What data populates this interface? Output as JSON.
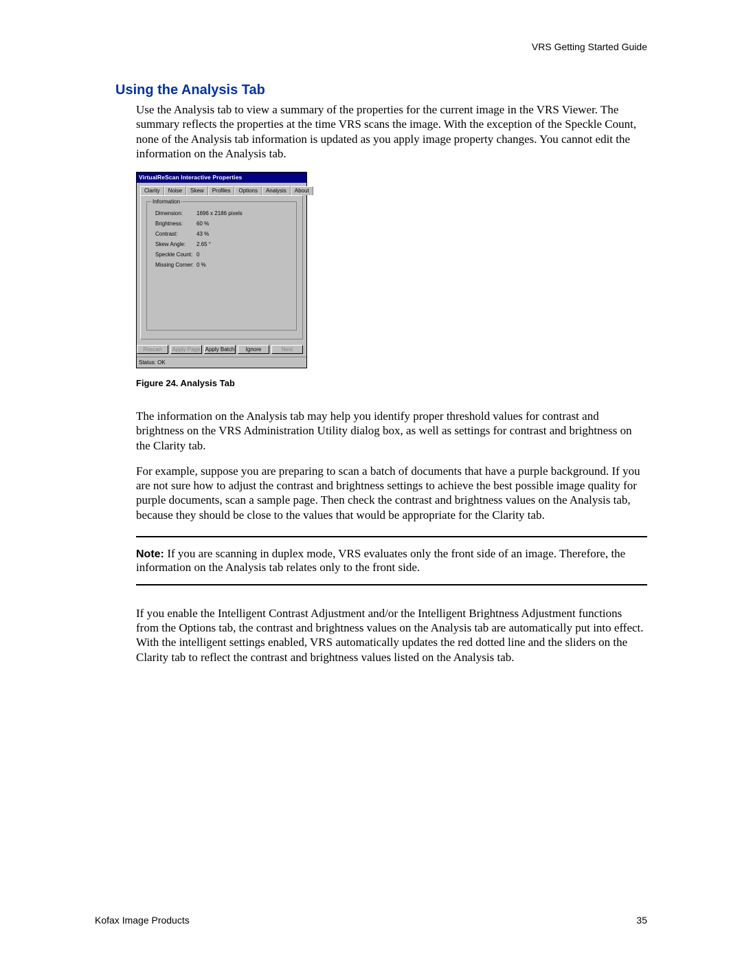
{
  "header": {
    "right": "VRS Getting Started Guide"
  },
  "section_title": "Using the Analysis Tab",
  "para1": "Use the Analysis tab to view a summary of the properties for the current image in the VRS Viewer. The summary reflects the properties at the time VRS scans the image. With the exception of the Speckle Count, none of the Analysis tab information is updated as you apply image property changes. You cannot edit the information on the Analysis tab.",
  "figure_caption": "Figure 24.  Analysis Tab",
  "para2": "The information on the Analysis tab may help you identify proper threshold values for contrast and brightness on the VRS Administration Utility dialog box, as well as settings for contrast and brightness on the Clarity tab.",
  "para3": "For example, suppose you are preparing to scan a batch of documents that have a purple background. If you are not sure how to adjust the contrast and brightness settings to achieve the best possible image quality for purple documents, scan a sample page. Then check the contrast and brightness values on the Analysis tab, because they should be close to the values that would be appropriate for the Clarity tab.",
  "note": {
    "label": "Note:  ",
    "text": "If you are scanning in duplex mode, VRS evaluates only the front side of an image. Therefore, the information on the Analysis tab relates only to the front side."
  },
  "para4": "If you enable the Intelligent Contrast Adjustment and/or the Intelligent Brightness Adjustment functions from the Options tab, the contrast and brightness values on the Analysis tab are automatically put into effect. With the intelligent settings enabled, VRS automatically updates the red dotted line and the sliders on the Clarity tab to reflect the contrast and brightness values listed on the Analysis tab.",
  "footer": {
    "left": "Kofax Image Products",
    "right": "35"
  },
  "dialog": {
    "title": "VirtualReScan Interactive Properties",
    "tabs": [
      "Clarity",
      "Noise",
      "Skew",
      "Profiles",
      "Options",
      "Analysis",
      "About"
    ],
    "active_tab": "Analysis",
    "group_title": "Information",
    "rows": [
      {
        "label": "Dimension:",
        "value": "1696 x 2186 pixels"
      },
      {
        "label": "Brightness:",
        "value": "60 %"
      },
      {
        "label": "Contrast:",
        "value": "43 %"
      },
      {
        "label": "Skew Angle:",
        "value": "2.65 °"
      },
      {
        "label": "Speckle Count:",
        "value": "0"
      },
      {
        "label": "Missing Corner:",
        "value": "0 %"
      }
    ],
    "buttons": {
      "rescan": "Rescan",
      "apply_page": "Apply Page",
      "apply_batch": "Apply Batch",
      "ignore": "Ignore",
      "next": "Next"
    },
    "status": "Status: OK"
  }
}
